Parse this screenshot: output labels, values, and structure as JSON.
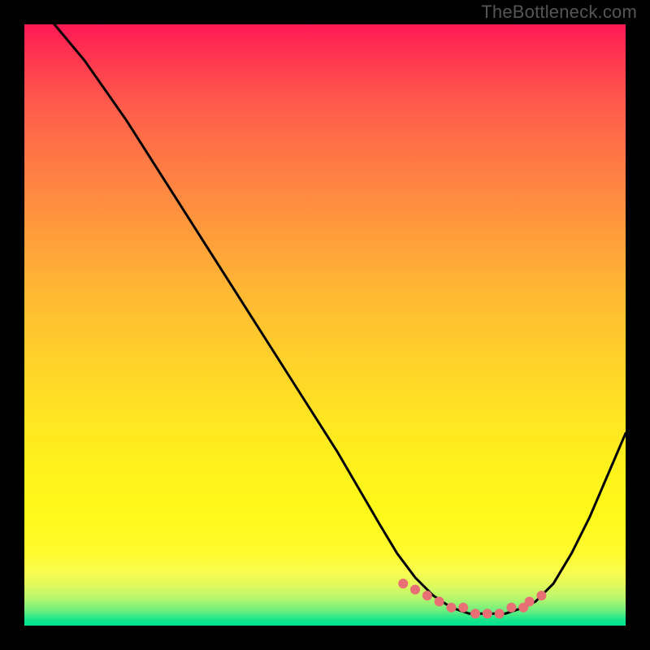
{
  "watermark": "TheBottleneck.com",
  "chart_data": {
    "type": "line",
    "title": "",
    "xlabel": "",
    "ylabel": "",
    "xlim": [
      0,
      100
    ],
    "ylim": [
      0,
      100
    ],
    "series": [
      {
        "name": "bottleneck-curve",
        "x": [
          5,
          10,
          17,
          24,
          31,
          38,
          45,
          52,
          59,
          62,
          65,
          68,
          71,
          74,
          77,
          80,
          83,
          85,
          88,
          91,
          94,
          97,
          100
        ],
        "values": [
          100,
          94,
          84,
          73,
          62,
          51,
          40,
          29,
          17,
          12,
          8,
          5,
          3,
          2,
          2,
          2,
          3,
          4,
          7,
          12,
          18,
          25,
          32
        ]
      }
    ],
    "markers": {
      "name": "highlight-dots",
      "x": [
        63,
        65,
        67,
        69,
        71,
        73,
        75,
        77,
        79,
        81,
        83,
        84,
        86
      ],
      "values": [
        7,
        6,
        5,
        4,
        3,
        3,
        2,
        2,
        2,
        3,
        3,
        4,
        5
      ]
    },
    "gradient_stops": [
      {
        "pct": 0,
        "color": "#ff1954"
      },
      {
        "pct": 50,
        "color": "#ffc72a"
      },
      {
        "pct": 88,
        "color": "#fffb2e"
      },
      {
        "pct": 100,
        "color": "#00e28f"
      }
    ]
  }
}
